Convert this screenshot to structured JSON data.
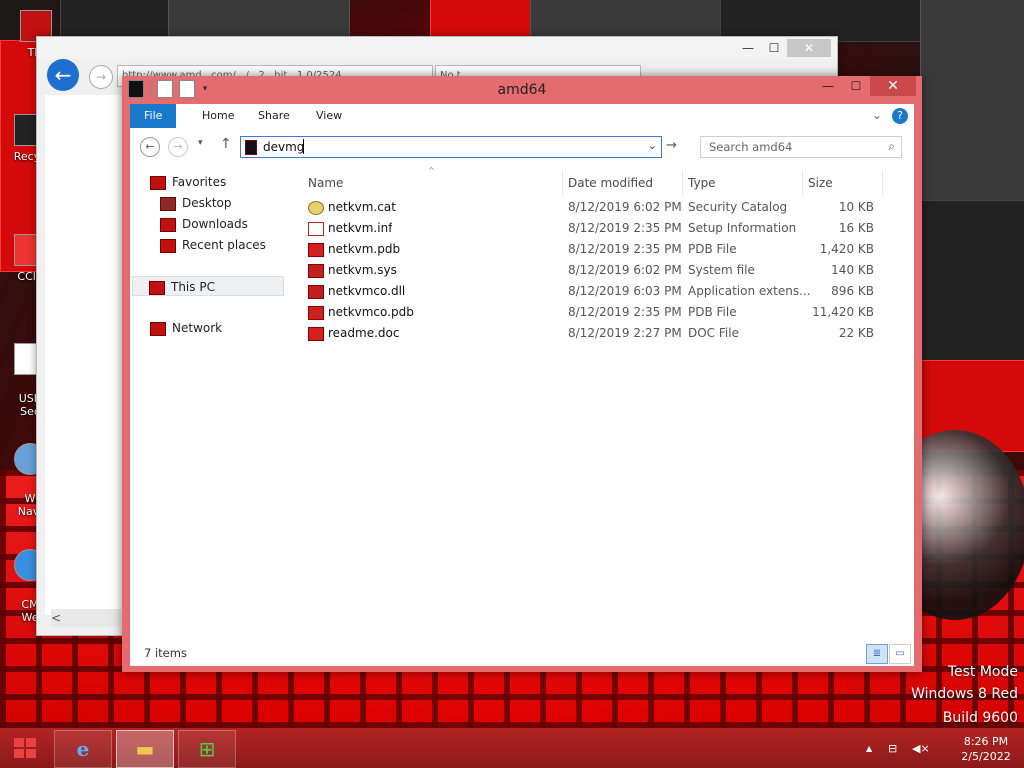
{
  "desktop": {
    "icons": [
      {
        "label": "Thi",
        "icon": "this-pc-icon"
      },
      {
        "label": "Recyc",
        "icon": "recycle-bin-icon"
      },
      {
        "label": "CCle",
        "icon": "ccleaner-icon"
      },
      {
        "label": "USB\nSec",
        "icon": "usb-icon"
      },
      {
        "label": "W\nNavi",
        "icon": "navigator-icon"
      },
      {
        "label": "CM\nWe",
        "icon": "ie-icon"
      }
    ],
    "watermark": {
      "line1": "Test Mode",
      "line2": "Windows 8 Red",
      "line3": "Build 9600"
    }
  },
  "browser": {
    "tab1_text": "http://www.amd...com/.../...2...hit...1.0/2524",
    "tab2_text": "No t...",
    "controls": {
      "minimize": "—",
      "maximize": "☐",
      "close": "✕"
    },
    "back_glyph": "←",
    "forward_glyph": "→",
    "scroll_left": "<"
  },
  "explorer": {
    "title": "amd64",
    "controls": {
      "minimize": "—",
      "maximize": "☐",
      "close": "✕"
    },
    "ribbon": {
      "tabs": [
        "File",
        "Home",
        "Share",
        "View"
      ],
      "expand_glyph": "⌄",
      "help_glyph": "?"
    },
    "nav": {
      "back_glyph": "←",
      "forward_glyph": "→",
      "recent_glyph": "▾",
      "up_glyph": "↑",
      "address_value": "devmg",
      "address_dropdown_glyph": "⌄",
      "go_glyph": "→",
      "search_placeholder": "Search amd64",
      "search_glyph": "⌕"
    },
    "tree": {
      "favorites": "Favorites",
      "desktop": "Desktop",
      "downloads": "Downloads",
      "recent_places": "Recent places",
      "this_pc": "This PC",
      "network": "Network"
    },
    "columns": {
      "name": "Name",
      "date": "Date modified",
      "type": "Type",
      "size": "Size",
      "sort_glyph": "^"
    },
    "files": [
      {
        "name": "netkvm.cat",
        "date": "8/12/2019 6:02 PM",
        "type": "Security Catalog",
        "size": "10 KB",
        "icon": "catalog-file-icon"
      },
      {
        "name": "netkvm.inf",
        "date": "8/12/2019 2:35 PM",
        "type": "Setup Information",
        "size": "16 KB",
        "icon": "setup-info-file-icon"
      },
      {
        "name": "netkvm.pdb",
        "date": "8/12/2019 2:35 PM",
        "type": "PDB File",
        "size": "1,420 KB",
        "icon": "pdb-file-icon"
      },
      {
        "name": "netkvm.sys",
        "date": "8/12/2019 6:02 PM",
        "type": "System file",
        "size": "140 KB",
        "icon": "system-file-icon"
      },
      {
        "name": "netkvmco.dll",
        "date": "8/12/2019 6:03 PM",
        "type": "Application extens...",
        "size": "896 KB",
        "icon": "dll-file-icon"
      },
      {
        "name": "netkvmco.pdb",
        "date": "8/12/2019 2:35 PM",
        "type": "PDB File",
        "size": "11,420 KB",
        "icon": "pdb-file-icon"
      },
      {
        "name": "readme.doc",
        "date": "8/12/2019 2:27 PM",
        "type": "DOC File",
        "size": "22 KB",
        "icon": "doc-file-icon"
      }
    ],
    "status": "7 items",
    "view_details_glyph": "≣",
    "view_icons_glyph": "▭"
  },
  "taskbar": {
    "apps": [
      {
        "name": "Internet Explorer",
        "icon": "ie-icon",
        "glyph": "e"
      },
      {
        "name": "File Explorer",
        "icon": "file-explorer-icon",
        "glyph": "▬"
      },
      {
        "name": "Store",
        "icon": "store-icon",
        "glyph": "⊞"
      }
    ],
    "tray": {
      "chevron": "▲",
      "network_glyph": "⊟",
      "volume_glyph": "◀×",
      "time": "8:26 PM",
      "date": "2/5/2022"
    }
  }
}
